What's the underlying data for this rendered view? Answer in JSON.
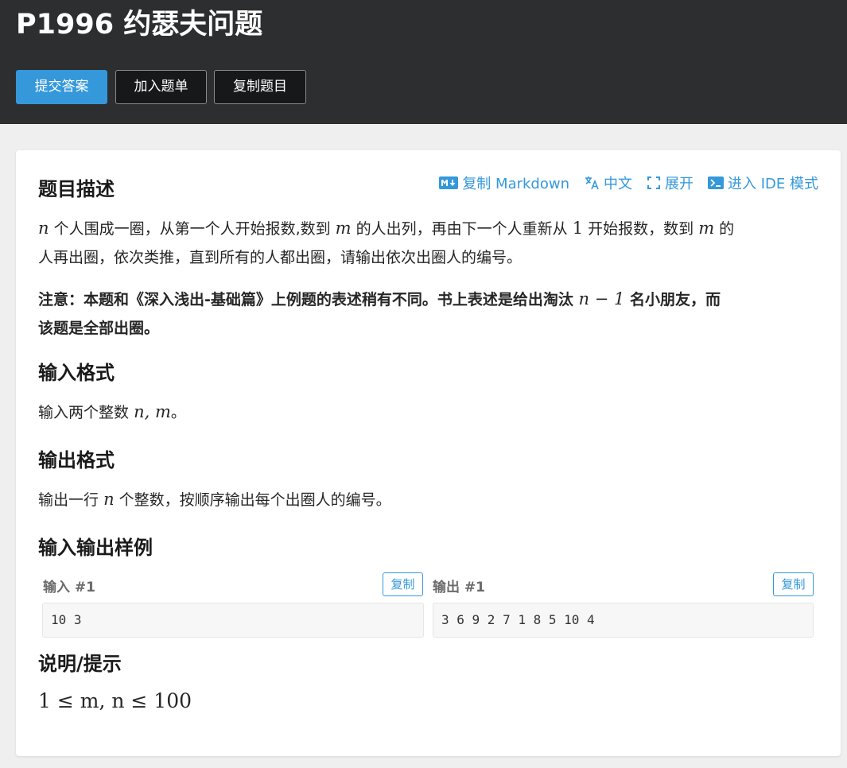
{
  "header": {
    "title": "P1996 约瑟夫问题",
    "submit_label": "提交答案",
    "add_label": "加入题单",
    "copy_label": "复制题目"
  },
  "actions": {
    "copy_markdown": "复制 Markdown",
    "language": "中文",
    "expand": "展开",
    "ide": "进入 IDE 模式"
  },
  "description": {
    "title": "题目描述",
    "p1_a": "个人围成一圈，从第一个人开始报数,数到",
    "p1_b": "的人出列，再由下一个人重新从",
    "p1_c": "开始报数，数到",
    "p1_d": "的",
    "p1_e": "人再出圈，依次类推，直到所有的人都出圈，请输出依次出圈人的编号。",
    "var_n": "n",
    "var_m": "m",
    "one": "1",
    "note_a": "注意：本题和《深入浅出-基础篇》上例题的表述稍有不同。书上表述是给出淘汰",
    "note_math": "n − 1",
    "note_b": "名小朋友，而",
    "note_c": "该题是全部出圈。"
  },
  "input_format": {
    "title": "输入格式",
    "text_a": "输入两个整数",
    "math": "n, m",
    "text_b": "。"
  },
  "output_format": {
    "title": "输出格式",
    "text_a": "输出一行",
    "math": "n",
    "text_b": "个整数，按顺序输出每个出圈人的编号。"
  },
  "samples": {
    "title": "输入输出样例",
    "input_label": "输入 #1",
    "output_label": "输出 #1",
    "copy_label": "复制",
    "input_value": "10 3",
    "output_value": "3 6 9 2 7 1 8 5 10 4"
  },
  "hint": {
    "title": "说明/提示",
    "math": "1 ≤ m, n ≤ 100"
  },
  "colors": {
    "header_bg": "#2d2e30",
    "accent": "#3498db",
    "page_bg": "#efefef"
  }
}
